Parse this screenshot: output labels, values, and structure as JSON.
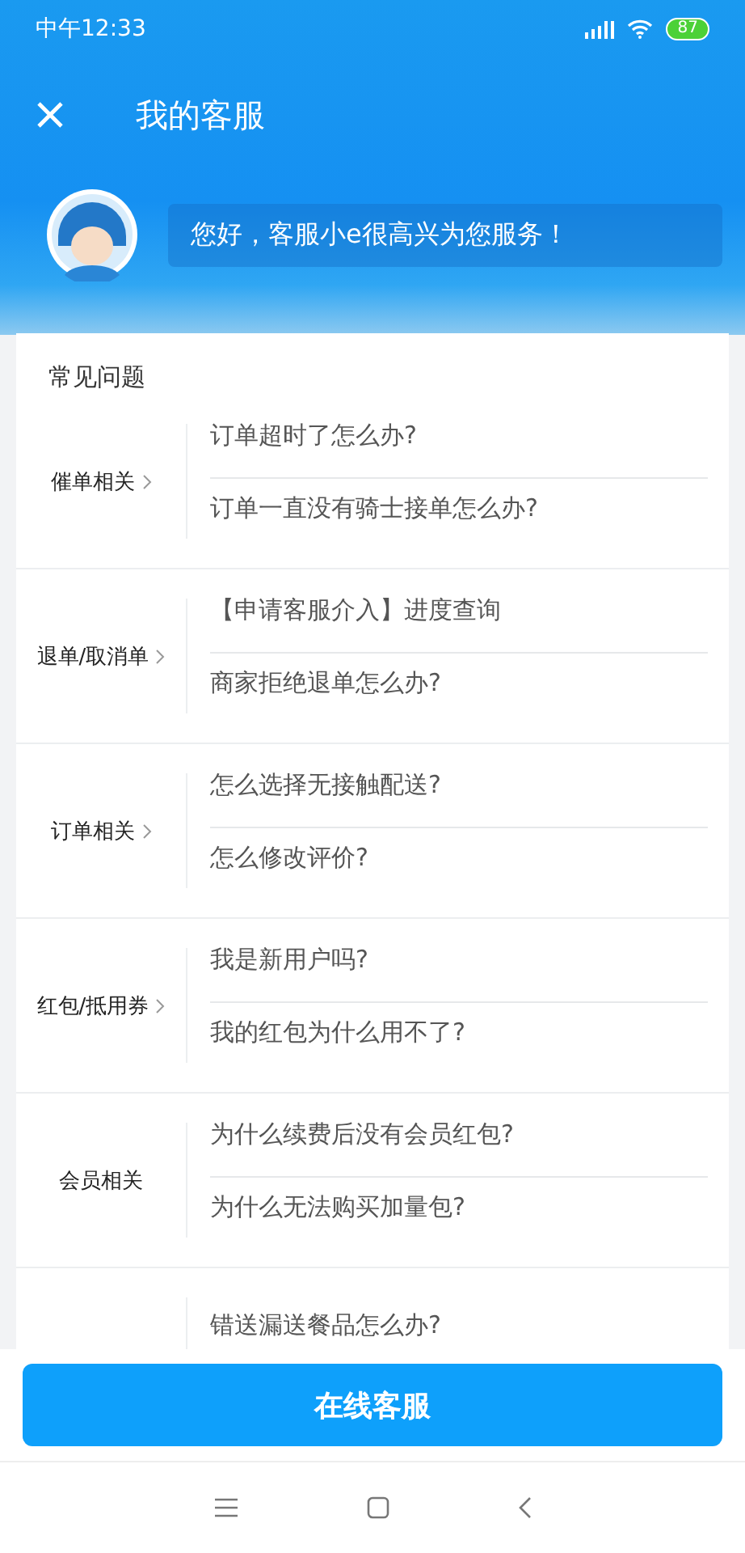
{
  "status_bar": {
    "time": "中午12:33",
    "battery": "87"
  },
  "header": {
    "title": "我的客服"
  },
  "greeting": {
    "message": "您好，客服小e很高兴为您服务！"
  },
  "faq": {
    "title": "常见问题",
    "categories": [
      {
        "label": "催单相关",
        "arrow": true,
        "questions": [
          "订单超时了怎么办?",
          "订单一直没有骑士接单怎么办?"
        ]
      },
      {
        "label": "退单/取消单",
        "arrow": true,
        "questions": [
          "【申请客服介入】进度查询",
          "商家拒绝退单怎么办?"
        ]
      },
      {
        "label": "订单相关",
        "arrow": true,
        "questions": [
          "怎么选择无接触配送?",
          "怎么修改评价?"
        ]
      },
      {
        "label": "红包/抵用券",
        "arrow": true,
        "questions": [
          "我是新用户吗?",
          "我的红包为什么用不了?"
        ]
      },
      {
        "label": "会员相关",
        "arrow": false,
        "questions": [
          "为什么续费后没有会员红包?",
          "为什么无法购买加量包?"
        ]
      },
      {
        "questions": [
          "错送漏送餐品怎么办?"
        ]
      }
    ]
  },
  "button": {
    "label": "在线客服"
  }
}
